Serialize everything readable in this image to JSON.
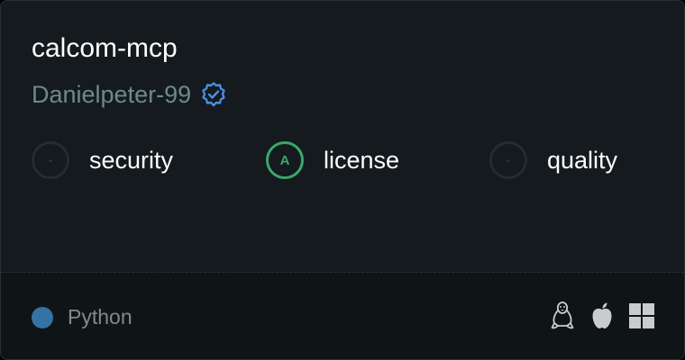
{
  "card": {
    "title": "calcom-mcp",
    "author": "Danielpeter-99",
    "verified_color": "#4a90e2"
  },
  "scores": [
    {
      "grade": "-",
      "label": "security",
      "graded": false
    },
    {
      "grade": "A",
      "label": "license",
      "graded": true
    },
    {
      "grade": "-",
      "label": "quality",
      "graded": false
    }
  ],
  "footer": {
    "language": "Python",
    "language_color": "#3572a5",
    "platforms": [
      "linux-icon",
      "apple-icon",
      "windows-icon"
    ]
  }
}
